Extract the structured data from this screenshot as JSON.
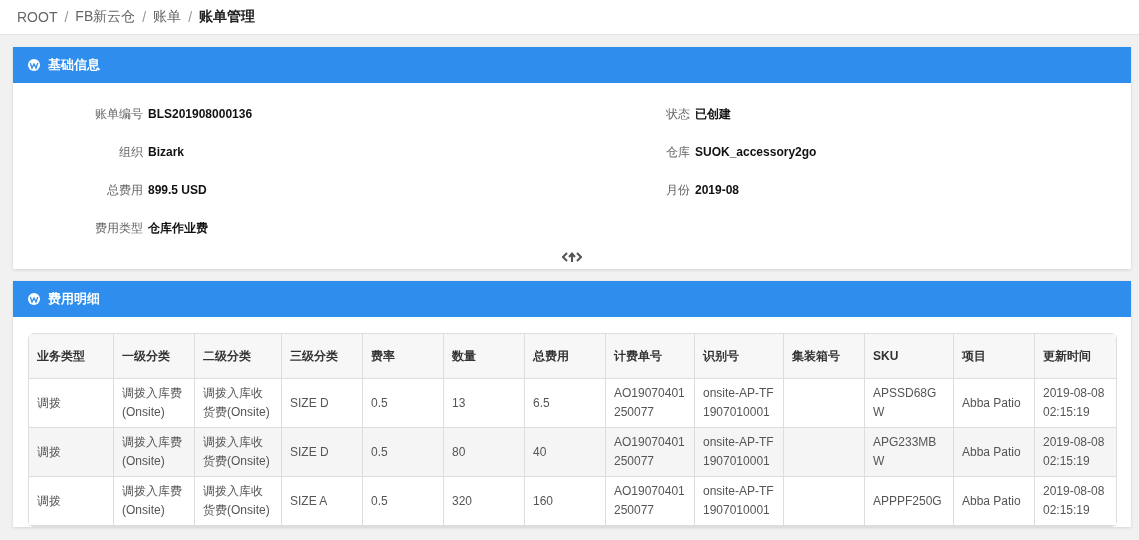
{
  "breadcrumb": [
    {
      "label": "ROOT",
      "current": false
    },
    {
      "label": "FB新云仓",
      "current": false
    },
    {
      "label": "账单",
      "current": false
    },
    {
      "label": "账单管理",
      "current": true
    }
  ],
  "separator": "/",
  "info_panel": {
    "title": "基础信息",
    "left_fields": [
      {
        "label": "账单编号",
        "value": "BLS201908000136"
      },
      {
        "label": "组织",
        "value": "Bizark"
      },
      {
        "label": "总费用",
        "value": "899.5 USD"
      },
      {
        "label": "费用类型",
        "value": "仓库作业费"
      }
    ],
    "right_fields": [
      {
        "label": "状态",
        "value": "已创建"
      },
      {
        "label": "仓库",
        "value": "SUOK_accessory2go"
      },
      {
        "label": "月份",
        "value": "2019-08"
      }
    ]
  },
  "detail_panel": {
    "title": "费用明细",
    "table": {
      "columns": [
        "业务类型",
        "一级分类",
        "二级分类",
        "三级分类",
        "费率",
        "数量",
        "总费用",
        "计费单号",
        "识别号",
        "集装箱号",
        "SKU",
        "项目",
        "更新时间"
      ],
      "rows": [
        [
          "调拨",
          "调拨入库费(Onsite)",
          "调拨入库收货费(Onsite)",
          "SIZE D",
          "0.5",
          "13",
          "6.5",
          "AO19070401250077",
          "onsite-AP-TF1907010001",
          "",
          "APSSD68GW",
          "Abba Patio",
          "2019-08-08 02:15:19"
        ],
        [
          "调拨",
          "调拨入库费(Onsite)",
          "调拨入库收货费(Onsite)",
          "SIZE D",
          "0.5",
          "80",
          "40",
          "AO19070401250077",
          "onsite-AP-TF1907010001",
          "",
          "APG233MBW",
          "Abba Patio",
          "2019-08-08 02:15:19"
        ],
        [
          "调拨",
          "调拨入库费(Onsite)",
          "调拨入库收货费(Onsite)",
          "SIZE A",
          "0.5",
          "320",
          "160",
          "AO19070401250077",
          "onsite-AP-TF1907010001",
          "",
          "APPPF250G",
          "Abba Patio",
          "2019-08-08 02:15:19"
        ]
      ]
    }
  }
}
